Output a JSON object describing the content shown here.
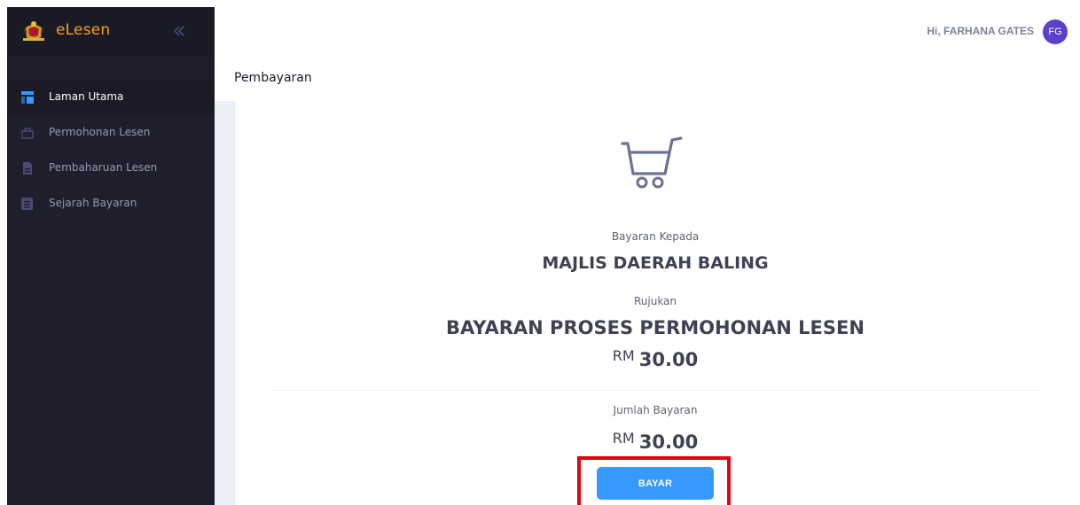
{
  "app": {
    "name": "eLesen"
  },
  "sidebar": {
    "items": [
      {
        "label": "Laman Utama",
        "icon": "layout-icon",
        "active": true
      },
      {
        "label": "Permohonan Lesen",
        "icon": "bag-icon",
        "active": false
      },
      {
        "label": "Pembaharuan Lesen",
        "icon": "file-icon",
        "active": false
      },
      {
        "label": "Sejarah Bayaran",
        "icon": "list-icon",
        "active": false
      }
    ]
  },
  "header": {
    "greeting": "Hi,",
    "user_name": "FARHANA GATES",
    "avatar_initials": "FG",
    "avatar_color": "#5e3fc9"
  },
  "page": {
    "title": "Pembayaran"
  },
  "payment": {
    "payee_label": "Bayaran Kepada",
    "payee": "MAJLIS DAERAH BALING",
    "reference_label": "Rujukan",
    "reference": "BAYARAN PROSES PERMOHONAN LESEN",
    "currency": "RM",
    "amount": "30.00",
    "total_label": "Jumlah Bayaran",
    "total_currency": "RM",
    "total_amount": "30.00",
    "pay_button": "BAYAR"
  },
  "colors": {
    "accent": "#3699ff",
    "brand": "#f0a21c",
    "sidebar_bg": "#1e1e2d",
    "highlight": "#e3000f"
  }
}
